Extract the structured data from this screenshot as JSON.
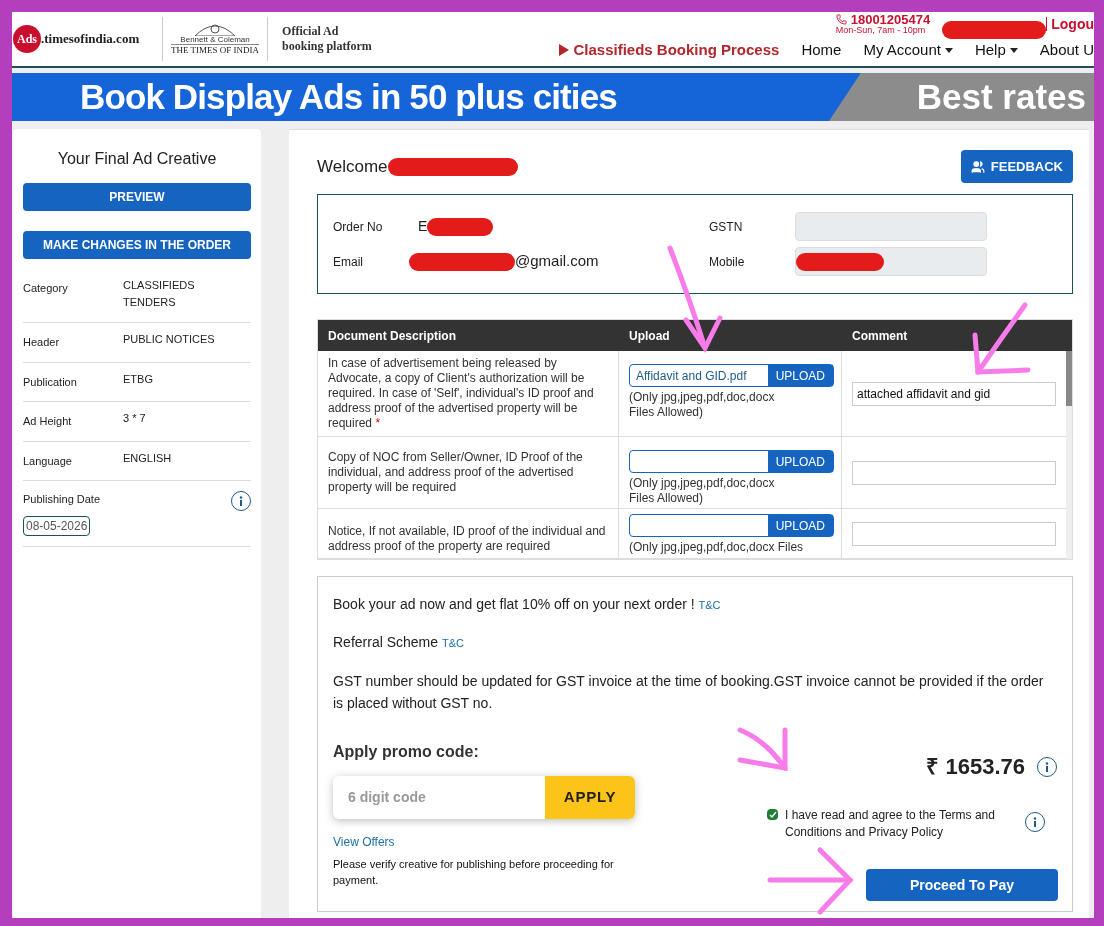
{
  "header": {
    "logo": {
      "badge": "Ads",
      "site": ".timesofindia.com"
    },
    "publisher": {
      "line1": "Bennett & Coleman",
      "line2": "THE TIMES OF INDIA"
    },
    "tagline": [
      "Official Ad",
      "booking platform"
    ],
    "phone": "18001205474",
    "hours": "Mon-Sun, 7am - 10pm",
    "logout": "Logou",
    "process_link": "Classifieds Booking Process",
    "nav": [
      {
        "label": "Home",
        "dropdown": false
      },
      {
        "label": "My Account",
        "dropdown": true
      },
      {
        "label": "Help",
        "dropdown": true
      },
      {
        "label": "About U",
        "dropdown": false
      }
    ]
  },
  "banner": {
    "headline": "Book Display Ads in 50 plus cities",
    "tag": "Best rates"
  },
  "sidebar": {
    "title": "Your Final Ad Creative",
    "buttons": [
      "PREVIEW",
      "MAKE CHANGES IN THE ORDER"
    ],
    "details": [
      {
        "label": "Category",
        "value": "CLASSIFIEDS TENDERS"
      },
      {
        "label": "Header",
        "value": "PUBLIC NOTICES"
      },
      {
        "label": "Publication",
        "value": "ETBG"
      },
      {
        "label": "Ad Height",
        "value": "3 * 7"
      },
      {
        "label": "Language",
        "value": "ENGLISH"
      }
    ],
    "publishing_date": {
      "label": "Publishing Date",
      "value": "08-05-2026"
    }
  },
  "welcome": "Welcome",
  "feedback": "FEEDBACK",
  "order": {
    "order_no": {
      "label": "Order No",
      "value": "E"
    },
    "email": {
      "label": "Email",
      "value": "@gmail.com"
    },
    "gstn": {
      "label": "GSTN"
    },
    "mobile": {
      "label": "Mobile"
    }
  },
  "documents": {
    "columns": [
      "Document Description",
      "Upload",
      "Comment"
    ],
    "rows": [
      {
        "description": "In case of advertisement being released by Advocate, a copy of Client's authorization will be required. In case of 'Self', individual's ID proof and address proof of the advertised property will be required",
        "required_mark": "*",
        "upload_button": "UPLOAD",
        "file": "Affidavit and GID.pdf",
        "hint": "(Only jpg,jpeg,pdf,doc,docx Files Allowed)",
        "comment": "attached affidavit and gid"
      },
      {
        "description": "Copy of NOC from Seller/Owner, ID Proof of the individual, and address proof of the advertised property will be required",
        "upload_button": "UPLOAD",
        "hint": "(Only jpg,jpeg,pdf,doc,docx Files Allowed)"
      },
      {
        "description": "Notice, If not available, ID proof of the individual and address proof of the property are required",
        "upload_button": "UPLOAD",
        "hint": "(Only jpg,jpeg,pdf,doc,docx Files"
      }
    ]
  },
  "summary": {
    "offer": "Book your ad now and get flat 10% off on your next order !",
    "offer_link": "T&C",
    "referral": "Referral Scheme",
    "referral_link": "T&C",
    "gst_note": "GST number should be updated for GST invoice at the time of booking.GST invoice cannot be provided if the order is placed without GST no.",
    "promo_title": "Apply promo code:",
    "promo_placeholder": "6 digit code",
    "apply": "APPLY",
    "view_offers": "View Offers",
    "verify_note": "Please verify creative for publishing before proceeding for payment.",
    "price": "₹ 1653.76",
    "agree": {
      "text": "I have read and agree to the Terms and Conditions and Privacy Policy",
      "checked": true
    },
    "proceed": "Proceed To Pay"
  }
}
